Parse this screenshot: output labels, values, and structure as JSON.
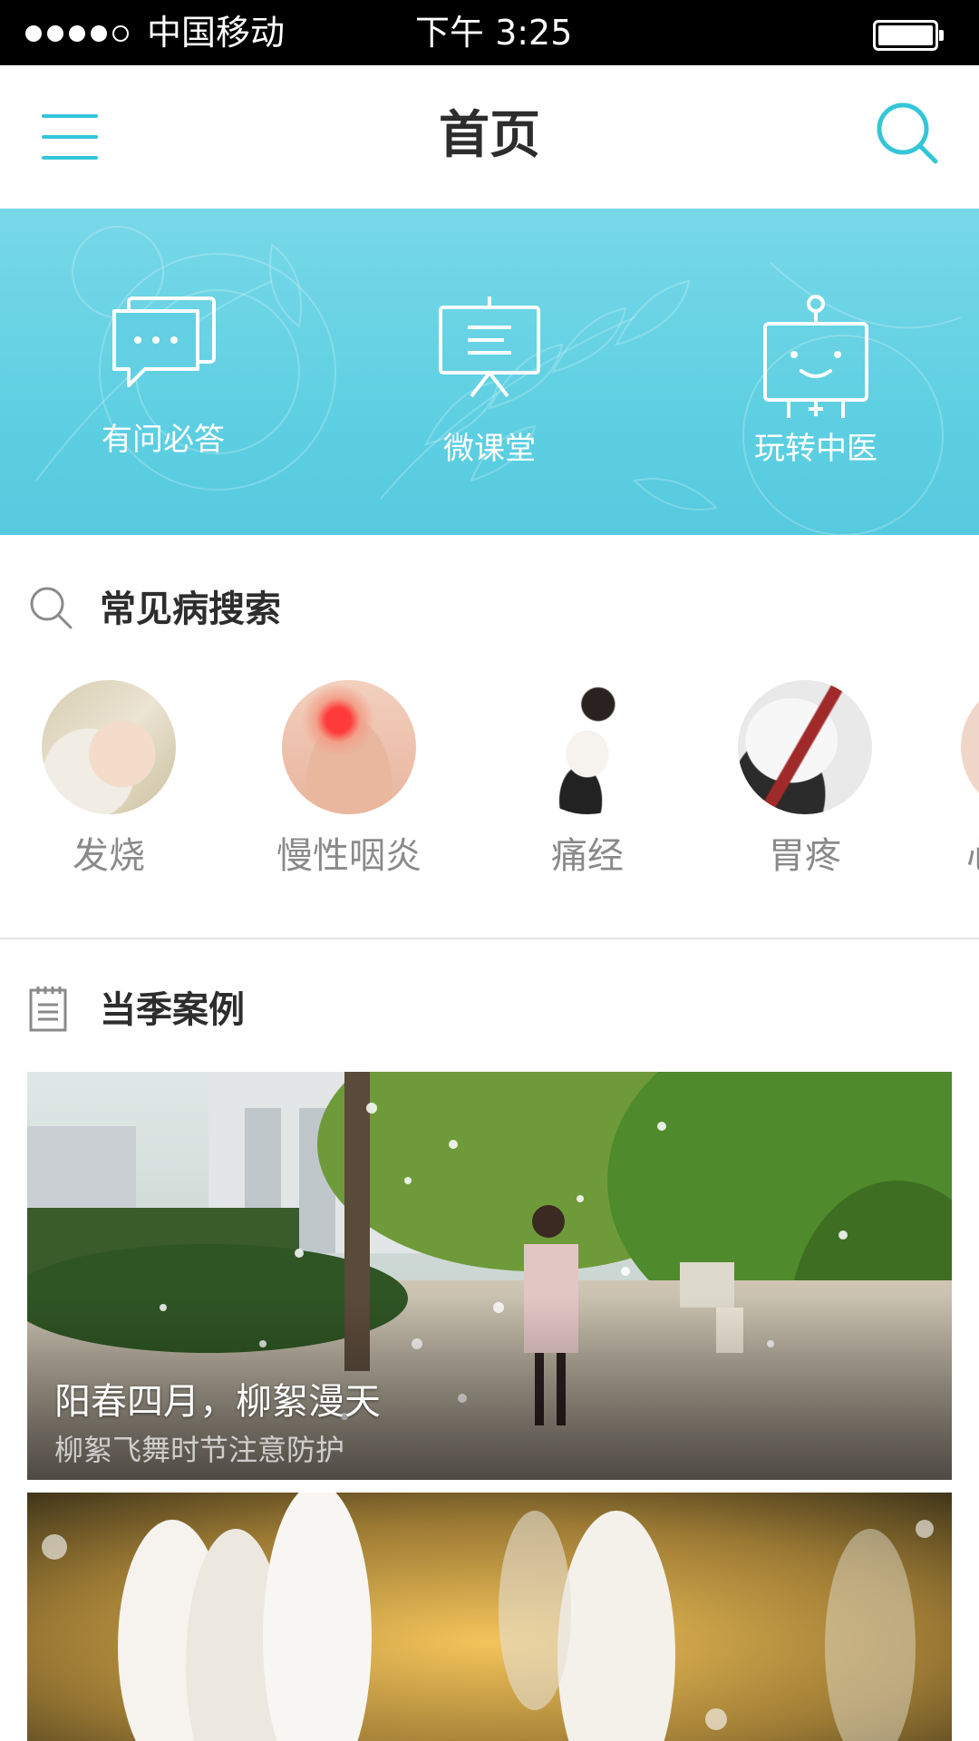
{
  "status_bar": {
    "carrier": "中国移动",
    "time": "下午 3:25",
    "signal_bars_filled": 4,
    "signal_bars_total": 5
  },
  "nav": {
    "title": "首页",
    "menu_icon": "hamburger-menu-icon",
    "search_icon": "search-icon",
    "accent_color": "#34c6d8"
  },
  "banner": {
    "items": [
      {
        "label": "有问必答",
        "icon": "chat-bubble-icon"
      },
      {
        "label": "微课堂",
        "icon": "presentation-board-icon"
      },
      {
        "label": "玩转中医",
        "icon": "robot-icon"
      }
    ],
    "background_color": "#5fd0e2"
  },
  "common_disease": {
    "title": "常见病搜索",
    "icon": "search-icon",
    "items": [
      {
        "label": "发烧",
        "image": "sleeping-baby-photo"
      },
      {
        "label": "慢性咽炎",
        "image": "sore-throat-photo"
      },
      {
        "label": "痛经",
        "image": "woman-cramps-photo"
      },
      {
        "label": "胃疼",
        "image": "stomach-ache-photo"
      },
      {
        "label": "心",
        "image": "partial-next-item"
      }
    ]
  },
  "seasonal_cases": {
    "title": "当季案例",
    "icon": "notepad-icon",
    "cards": [
      {
        "title": "阳春四月，柳絮漫天",
        "subtitle": "柳絮飞舞时节注意防护",
        "image": "willow-catkins-street-photo"
      },
      {
        "title": "",
        "subtitle": "",
        "image": "white-crocus-flowers-photo"
      }
    ]
  }
}
